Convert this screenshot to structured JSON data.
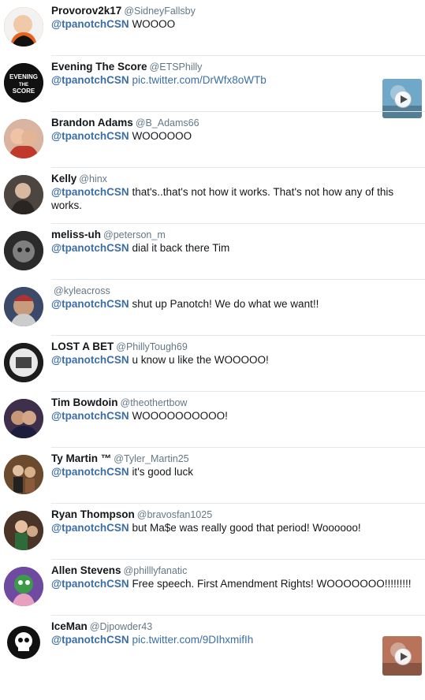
{
  "tweets": [
    {
      "name": "Provorov2k17",
      "handle": "@SidneyFallsby",
      "mention": "@tpanotchCSN",
      "text": "WOOOO",
      "link": "",
      "avatar_color": "#e86a1e",
      "media": false
    },
    {
      "name": "Evening The Score",
      "handle": "@ETSPhilly",
      "mention": "@tpanotchCSN",
      "text": "",
      "link": "pic.twitter.com/DrWfx8oWTb",
      "avatar_color": "#111111",
      "media": true,
      "media_color": "#6fa8c8"
    },
    {
      "name": "Brandon Adams",
      "handle": "@B_Adams66",
      "mention": "@tpanotchCSN",
      "text": "WOOOOOO",
      "link": "",
      "avatar_color": "#c25a3a",
      "media": false
    },
    {
      "name": "Kelly",
      "handle": "@hinx",
      "mention": "@tpanotchCSN",
      "text": "that's..that's not how it works. That's not how any of this works.",
      "link": "",
      "avatar_color": "#5b4f4a",
      "media": false
    },
    {
      "name": "meliss-uh",
      "handle": "@peterson_m",
      "mention": "@tpanotchCSN",
      "text": "dial it back there Tim",
      "link": "",
      "avatar_color": "#2b2b2b",
      "media": false
    },
    {
      "name": "",
      "handle": "@kyleacross",
      "mention": "@tpanotchCSN",
      "text": "shut up Panotch! We do what we want!!",
      "link": "",
      "avatar_color": "#7a6a60",
      "media": false
    },
    {
      "name": "LOST A BET",
      "handle": "@PhillyTough69",
      "mention": "@tpanotchCSN",
      "text": "u know u like the WOOOOO!",
      "link": "",
      "avatar_color": "#1c1c1c",
      "media": false
    },
    {
      "name": "Tim Bowdoin",
      "handle": "@theothertbow",
      "mention": "@tpanotchCSN",
      "text": "WOOOOOOOOOO!",
      "link": "",
      "avatar_color": "#4a3550",
      "media": false
    },
    {
      "name": "Ty Martin ™",
      "handle": "@Tyler_Martin25",
      "mention": "@tpanotchCSN",
      "text": "it's good luck",
      "link": "",
      "avatar_color": "#6b4a2e",
      "media": false
    },
    {
      "name": "Ryan Thompson",
      "handle": "@bravosfan1025",
      "mention": "@tpanotchCSN",
      "text": "but Ma$e was really good that period! Woooooo!",
      "link": "",
      "avatar_color": "#5a4030",
      "media": false
    },
    {
      "name": "Allen Stevens",
      "handle": "@philllyfanatic",
      "mention": "@tpanotchCSN",
      "text": "Free speech.  First Amendment Rights!  WOOOOOOO!!!!!!!!!",
      "link": "",
      "avatar_color": "#6e4aa0",
      "media": false
    },
    {
      "name": "IceMan",
      "handle": "@Djpowder43",
      "mention": "@tpanotchCSN",
      "text": "",
      "link": "pic.twitter.com/9DIhxmifIh",
      "avatar_color": "#ffffff",
      "media": true,
      "media_color": "#b8735a"
    }
  ]
}
